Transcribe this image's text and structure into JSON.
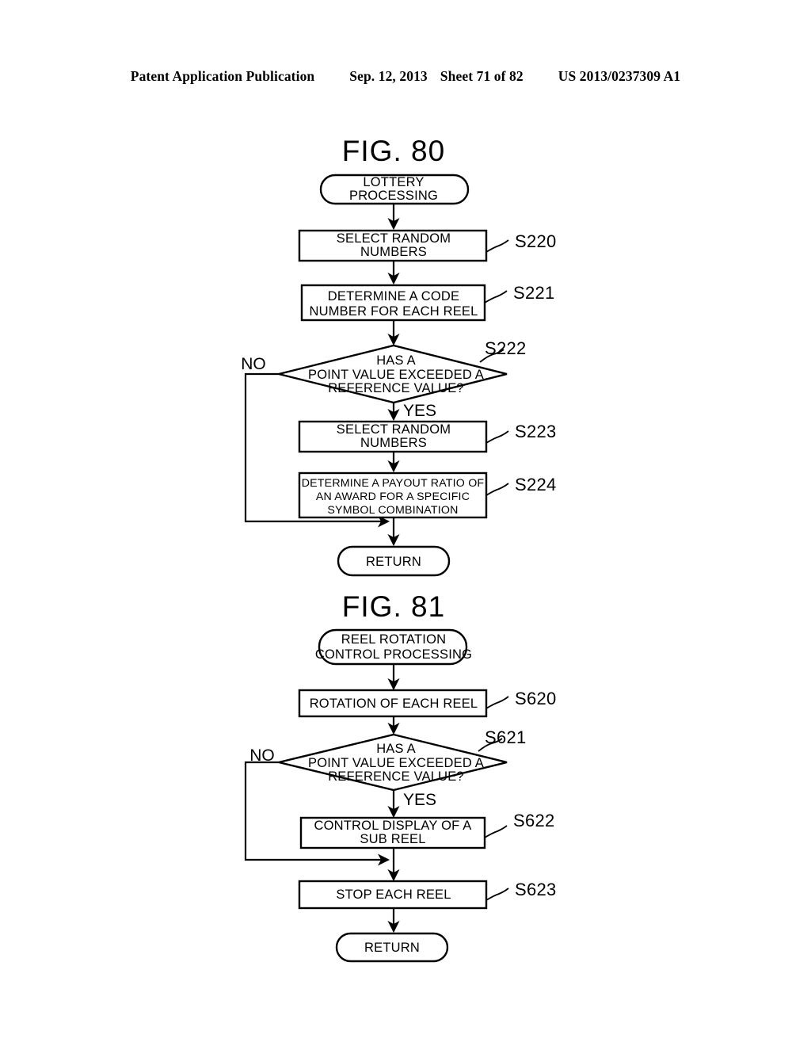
{
  "header": {
    "publication": "Patent Application Publication",
    "date": "Sep. 12, 2013",
    "sheet": "Sheet 71 of 82",
    "patent_number": "US 2013/0237309 A1"
  },
  "figures": [
    {
      "title": "FIG. 80",
      "nodes": {
        "start": "LOTTERY PROCESSING",
        "start_line1": "LOTTERY",
        "start_line2": "PROCESSING",
        "s220_line1": "SELECT RANDOM",
        "s220_line2": "NUMBERS",
        "s221_line1": "DETERMINE A CODE",
        "s221_line2": "NUMBER FOR EACH REEL",
        "s222_line1": "HAS A",
        "s222_line2": "POINT VALUE EXCEEDED A",
        "s222_line3": "REFERENCE VALUE?",
        "s223_line1": "SELECT RANDOM",
        "s223_line2": "NUMBERS",
        "s224_line1": "DETERMINE A PAYOUT RATIO OF",
        "s224_line2": "AN AWARD FOR A SPECIFIC",
        "s224_line3": "SYMBOL COMBINATION",
        "end": "RETURN"
      },
      "step_labels": {
        "s220": "S220",
        "s221": "S221",
        "s222": "S222",
        "s223": "S223",
        "s224": "S224"
      },
      "branch_labels": {
        "no": "NO",
        "yes": "YES"
      }
    },
    {
      "title": "FIG. 81",
      "nodes": {
        "start_line1": "REEL ROTATION",
        "start_line2": "CONTROL PROCESSING",
        "s620": "ROTATION OF EACH REEL",
        "s621_line1": "HAS A",
        "s621_line2": "POINT VALUE EXCEEDED A",
        "s621_line3": "REFERENCE VALUE?",
        "s622_line1": "CONTROL DISPLAY OF A",
        "s622_line2": "SUB REEL",
        "s623": "STOP EACH REEL",
        "end": "RETURN"
      },
      "step_labels": {
        "s620": "S620",
        "s621": "S621",
        "s622": "S622",
        "s623": "S623"
      },
      "branch_labels": {
        "no": "NO",
        "yes": "YES"
      }
    }
  ],
  "colors": {
    "ink": "#000000",
    "paper": "#ffffff"
  }
}
